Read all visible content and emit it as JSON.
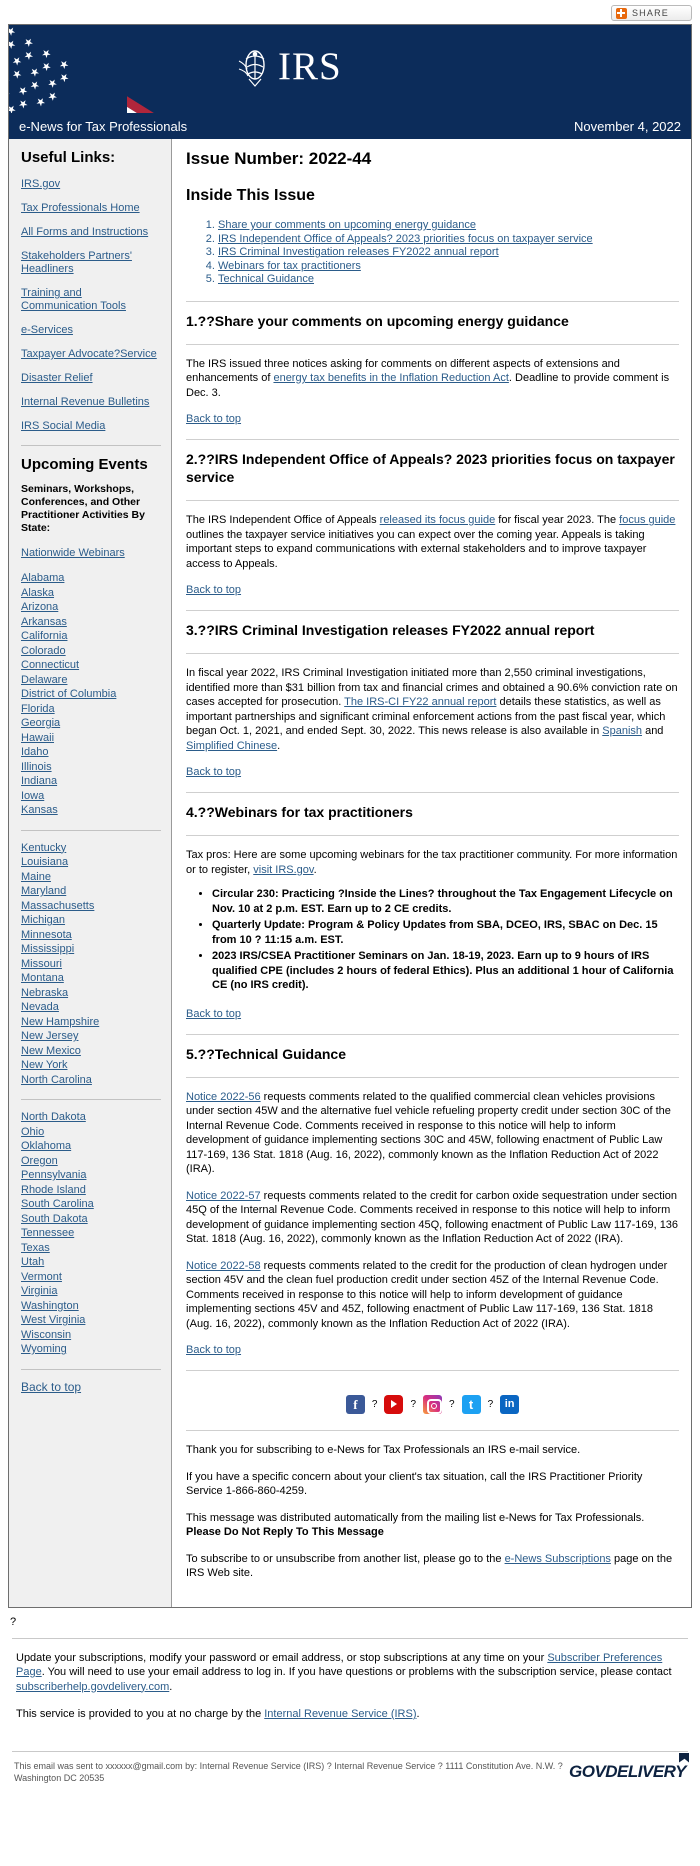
{
  "share": {
    "label": "SHARE",
    "icon": "share-plus-icon"
  },
  "masthead": {
    "logo_text": "IRS",
    "logo_alt": "irs-eagle-seal-icon"
  },
  "titlebar": {
    "publication": "e-News for Tax Professionals",
    "date": "November 4, 2022"
  },
  "sidebar": {
    "useful_links_heading": "Useful Links:",
    "useful_links": [
      "IRS.gov",
      "Tax Professionals Home",
      "All Forms and Instructions",
      "Stakeholders Partners' Headliners",
      "Training and Communication Tools",
      "e-Services",
      "Taxpayer Advocate?Service",
      "Disaster Relief",
      "Internal Revenue Bulletins",
      "IRS Social Media"
    ],
    "upcoming_events_heading": "Upcoming Events",
    "upcoming_events_sub": "Seminars, Workshops, Conferences, and Other Practitioner Activities By State:",
    "nationwide_webinars": "Nationwide Webinars",
    "states_group1": [
      "Alabama",
      "Alaska",
      "Arizona",
      "Arkansas",
      "California",
      "Colorado",
      "Connecticut",
      "Delaware",
      "District of Columbia",
      "Florida",
      "Georgia",
      "Hawaii",
      "Idaho",
      "Illinois",
      "Indiana",
      "Iowa",
      "Kansas"
    ],
    "states_group2": [
      "Kentucky",
      "Louisiana",
      "Maine",
      "Maryland",
      "Massachusetts",
      "Michigan",
      "Minnesota",
      "Mississippi",
      "Missouri",
      "Montana",
      "Nebraska",
      "Nevada",
      "New Hampshire",
      "New Jersey",
      "New Mexico",
      "New York",
      "North Carolina"
    ],
    "states_group3": [
      "North Dakota",
      "Ohio",
      "Oklahoma",
      "Oregon",
      "Pennsylvania",
      "Rhode Island",
      "South Carolina",
      "South Dakota",
      "Tennessee",
      "Texas",
      "Utah",
      "Vermont",
      "Virginia",
      "Washington",
      "West Virginia",
      "Wisconsin",
      "Wyoming"
    ],
    "back_to_top": "Back to top"
  },
  "main": {
    "issue_number": "Issue Number: 2022-44",
    "inside_heading": "Inside This Issue",
    "toc": [
      "Share your comments on upcoming energy guidance",
      "IRS Independent Office of Appeals? 2023 priorities focus on taxpayer service",
      "IRS Criminal Investigation releases FY2022 annual report",
      "Webinars for tax practitioners",
      "Technical Guidance"
    ],
    "back_to_top": "Back to top",
    "sections": [
      {
        "heading": "1.??Share your comments on upcoming energy guidance",
        "body_pre": "The IRS issued three notices asking for comments on different aspects of extensions and enhancements of ",
        "body_link": "energy tax benefits in the Inflation Reduction Act",
        "body_post": ". Deadline to provide comment is Dec. 3."
      },
      {
        "heading": "2.??IRS Independent Office of Appeals? 2023 priorities focus on taxpayer service",
        "body_pre": "The IRS Independent Office of Appeals ",
        "body_link": "released its focus guide",
        "body_mid": " for fiscal year 2023. The ",
        "body_link2": "focus guide",
        "body_post": " outlines the taxpayer service initiatives you can expect over the coming year. Appeals is taking important steps to expand communications with external stakeholders and to improve taxpayer access to Appeals."
      },
      {
        "heading": "3.??IRS Criminal Investigation releases FY2022 annual report",
        "body_pre": "In fiscal year 2022, IRS Criminal Investigation initiated more than 2,550 criminal investigations, identified more than $31 billion from tax and financial crimes and obtained a 90.6% conviction rate on cases accepted for prosecution. ",
        "body_link": "The IRS-CI FY22 annual report",
        "body_mid": " details these statistics, as well as important partnerships and significant criminal enforcement actions from the past fiscal year, which began Oct. 1, 2021, and ended Sept. 30, 2022. This news release is also available in ",
        "body_link2": "Spanish",
        "body_mid2": " and ",
        "body_link3": "Simplified Chinese",
        "body_post": "."
      },
      {
        "heading": "4.??Webinars for tax practitioners",
        "body_pre": "Tax pros: Here are some upcoming webinars for the tax practitioner community. For more information or to register, ",
        "body_link": "visit IRS.gov",
        "body_post": ".",
        "bullets": [
          "Circular 230: Practicing ?Inside the Lines? throughout the Tax Engagement Lifecycle on Nov. 10 at 2 p.m. EST. Earn up to 2 CE credits.",
          "Quarterly Update: Program & Policy Updates from SBA, DCEO, IRS, SBAC on Dec. 15 from 10 ? 11:15 a.m. EST.",
          "2023 IRS/CSEA Practitioner Seminars on Jan. 18-19, 2023. Earn up to 9 hours of IRS qualified CPE (includes 2 hours of federal Ethics). Plus an additional 1 hour of California CE (no IRS credit)."
        ]
      },
      {
        "heading": "5.??Technical Guidance",
        "paragraphs": [
          {
            "link": "Notice 2022-56",
            "text": " requests comments related to the qualified commercial clean vehicles provisions under section 45W and the alternative fuel vehicle refueling property credit under section 30C of the Internal Revenue Code. Comments received in response to this notice will help to inform development of guidance implementing sections 30C and 45W, following enactment of Public Law 117-169, 136 Stat. 1818 (Aug. 16, 2022), commonly known as the Inflation Reduction Act of 2022 (IRA)."
          },
          {
            "link": "Notice 2022-57",
            "text": " requests comments related to the credit for carbon oxide sequestration under section 45Q of the Internal Revenue Code. Comments received in response to this notice will help to inform development of guidance implementing section 45Q, following enactment of Public Law 117-169, 136 Stat. 1818 (Aug. 16, 2022), commonly known as the Inflation Reduction Act of 2022 (IRA)."
          },
          {
            "link": "Notice 2022-58",
            "text": " requests comments related to the credit for the production of clean hydrogen under section 45V and the clean fuel production credit under section 45Z of the Internal Revenue Code. Comments received in response to this notice will help to inform development of guidance implementing sections 45V and 45Z, following enactment of Public Law 117-169, 136 Stat. 1818 (Aug. 16, 2022), commonly known as the Inflation Reduction Act of 2022 (IRA)."
          }
        ]
      }
    ],
    "social": [
      {
        "name": "facebook-icon",
        "glyph": "f"
      },
      {
        "name": "youtube-icon",
        "glyph": ""
      },
      {
        "name": "instagram-icon",
        "glyph": ""
      },
      {
        "name": "twitter-icon",
        "glyph": "t"
      },
      {
        "name": "linkedin-icon",
        "glyph": "in"
      }
    ],
    "social_sep": "?",
    "footer_thanks": "Thank you for subscribing to e-News for Tax Professionals an IRS e-mail service.",
    "footer_concern": "If you have a specific concern about your client's tax situation, call the IRS Practitioner Priority Service 1-866-860-4259.",
    "footer_distributed_pre": "This message was distributed automatically from the mailing list e-News for Tax Professionals. ",
    "footer_distributed_bold": "Please Do Not Reply To This Message",
    "footer_subscribe_pre": "To subscribe to or unsubscribe from another list, please go to the ",
    "footer_subscribe_link": "e-News Subscriptions",
    "footer_subscribe_post": " page on the IRS Web site."
  },
  "stray_char": "?",
  "bottom": {
    "update_pre": "Update your subscriptions, modify your password or email address, or stop subscriptions at any time on your ",
    "update_link": "Subscriber Preferences Page",
    "update_mid": ". You will need to use your email address to log in. If you have questions or problems with the subscription service, please contact ",
    "update_link2": "subscriberhelp.govdelivery.com",
    "update_post": ".",
    "service_pre": "This service is provided to you at no charge by the ",
    "service_link": "Internal Revenue Service (IRS)",
    "service_post": ".",
    "sent_to": "This email was sent to xxxxxx@gmail.com by: Internal Revenue Service (IRS) ? Internal Revenue Service ? 1111 Constitution Ave. N.W. ? Washington DC 20535",
    "govdelivery": "GOVDELIVERY"
  }
}
